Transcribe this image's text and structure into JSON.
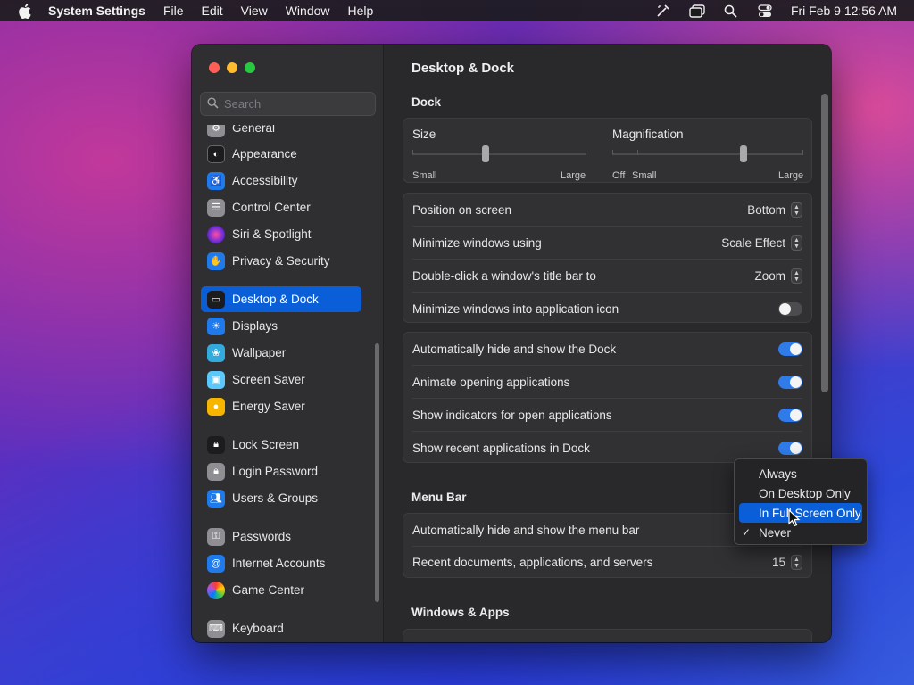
{
  "menubar": {
    "app_name": "System Settings",
    "items": [
      "File",
      "Edit",
      "View",
      "Window",
      "Help"
    ],
    "clock": "Fri Feb 9  12:56 AM"
  },
  "window": {
    "search_placeholder": "Search",
    "sidebar": {
      "items": [
        {
          "label": "General",
          "icon": "gear-icon",
          "color": "#8e8e93"
        },
        {
          "label": "Appearance",
          "icon": "appearance-icon",
          "color": "#1c1c1e"
        },
        {
          "label": "Accessibility",
          "icon": "accessibility-icon",
          "color": "#1f7aec"
        },
        {
          "label": "Control Center",
          "icon": "control-center-icon",
          "color": "#8e8e93"
        },
        {
          "label": "Siri & Spotlight",
          "icon": "siri-icon",
          "color": "#7c3aed"
        },
        {
          "label": "Privacy & Security",
          "icon": "hand-icon",
          "color": "#1f7aec"
        },
        {
          "label": "Desktop & Dock",
          "icon": "dock-icon",
          "color": "#1c1c1e"
        },
        {
          "label": "Displays",
          "icon": "sun-icon",
          "color": "#1f7aec"
        },
        {
          "label": "Wallpaper",
          "icon": "flower-icon",
          "color": "#34aadc"
        },
        {
          "label": "Screen Saver",
          "icon": "screen-saver-icon",
          "color": "#5ac8fa"
        },
        {
          "label": "Energy Saver",
          "icon": "bulb-icon",
          "color": "#f7b500"
        },
        {
          "label": "Lock Screen",
          "icon": "lock-icon",
          "color": "#1c1c1e"
        },
        {
          "label": "Login Password",
          "icon": "lock-icon",
          "color": "#8e8e93"
        },
        {
          "label": "Users & Groups",
          "icon": "users-icon",
          "color": "#1f7aec"
        },
        {
          "label": "Passwords",
          "icon": "key-icon",
          "color": "#8e8e93"
        },
        {
          "label": "Internet Accounts",
          "icon": "at-icon",
          "color": "#1f7aec"
        },
        {
          "label": "Game Center",
          "icon": "game-center-icon",
          "color": "#ffffff"
        },
        {
          "label": "Keyboard",
          "icon": "keyboard-icon",
          "color": "#8e8e93"
        }
      ],
      "selected": "Desktop & Dock"
    },
    "main": {
      "title": "Desktop & Dock",
      "dock_section": "Dock",
      "size": {
        "title": "Size",
        "min": "Small",
        "max": "Large",
        "value": 0.42
      },
      "magnification": {
        "title": "Magnification",
        "off": "Off",
        "min": "Small",
        "max": "Large",
        "value": 0.68
      },
      "position_label": "Position on screen",
      "position_value": "Bottom",
      "minimize_label": "Minimize windows using",
      "minimize_value": "Scale Effect",
      "doubleclick_label": "Double-click a window's title bar to",
      "doubleclick_value": "Zoom",
      "minimize_icon_label": "Minimize windows into application icon",
      "minimize_icon_on": false,
      "autohide_label": "Automatically hide and show the Dock",
      "autohide_on": true,
      "animate_label": "Animate opening applications",
      "animate_on": true,
      "indicators_label": "Show indicators for open applications",
      "indicators_on": true,
      "recent_label": "Show recent applications in Dock",
      "recent_on": true,
      "menubar_section": "Menu Bar",
      "menubar_autohide_label": "Automatically hide and show the menu bar",
      "recent_docs_label": "Recent documents, applications, and servers",
      "recent_docs_value": "15",
      "windows_section": "Windows & Apps"
    }
  },
  "dropdown": {
    "options": [
      "Always",
      "On Desktop Only",
      "In Full Screen Only",
      "Never"
    ],
    "highlighted": "In Full Screen Only",
    "checked": "Never"
  },
  "colors": {
    "accent": "#0a5fd8",
    "toggle_on": "#2f7bea"
  }
}
